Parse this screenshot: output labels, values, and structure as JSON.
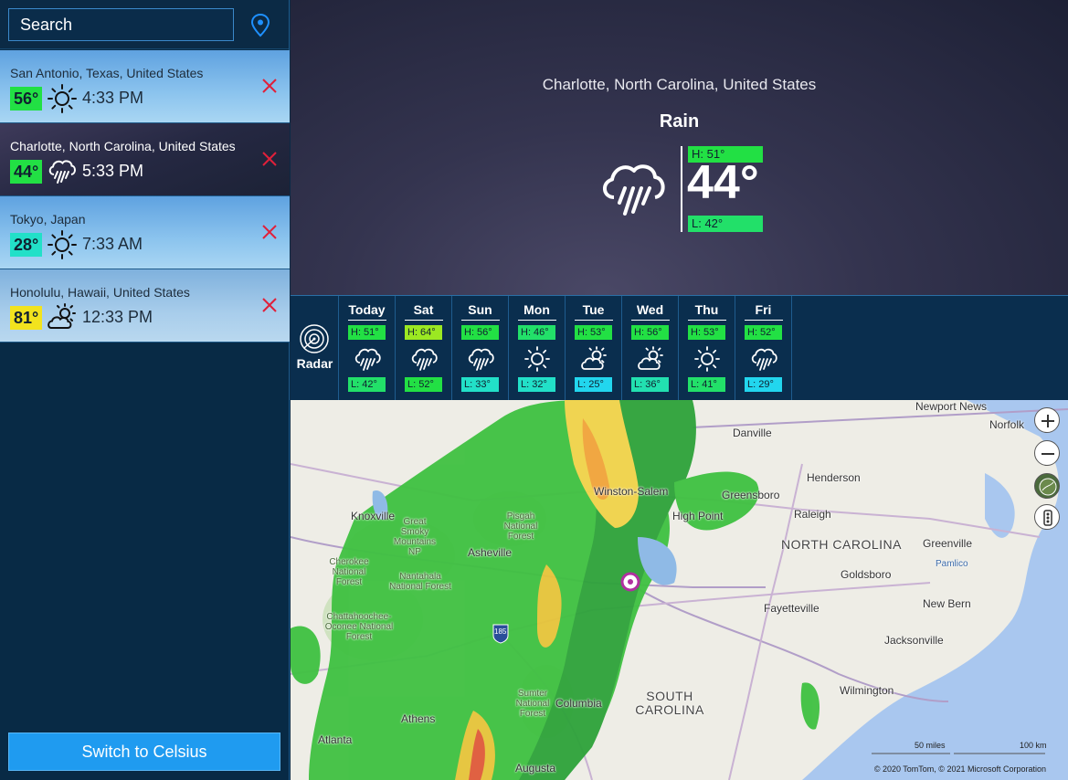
{
  "search": {
    "placeholder": "Search"
  },
  "cities": [
    {
      "name": "San Antonio, Texas, United States",
      "temp": "56°",
      "time": "4:33 PM",
      "icon": "sun-icon",
      "badge_color": "#22e044"
    },
    {
      "name": "Charlotte, North Carolina, United States",
      "temp": "44°",
      "time": "5:33 PM",
      "icon": "rain-icon",
      "badge_color": "#22e044"
    },
    {
      "name": "Tokyo, Japan",
      "temp": "28°",
      "time": "7:33 AM",
      "icon": "sun-icon",
      "badge_color": "#22e0c8"
    },
    {
      "name": "Honolulu, Hawaii, United States",
      "temp": "81°",
      "time": "12:33 PM",
      "icon": "partly-cloudy-icon",
      "badge_color": "#f2e31e"
    }
  ],
  "switch_button": {
    "label": "Switch to Celsius"
  },
  "current": {
    "location": "Charlotte, North Carolina, United States",
    "condition": "Rain",
    "temp": "44°",
    "high": "H: 51°",
    "low": "L: 42°",
    "icon": "rain-icon"
  },
  "radar": {
    "label": "Radar",
    "icon": "radar-icon"
  },
  "forecast": [
    {
      "day": "Today",
      "high": "H: 51°",
      "low": "L: 42°",
      "icon": "rain-icon",
      "high_color": "#22e044",
      "low_color": "#22e069"
    },
    {
      "day": "Sat",
      "high": "H: 64°",
      "low": "L: 52°",
      "icon": "rain-icon",
      "high_color": "#9be822",
      "low_color": "#22e044"
    },
    {
      "day": "Sun",
      "high": "H: 56°",
      "low": "L: 33°",
      "icon": "rain-icon",
      "high_color": "#22e044",
      "low_color": "#22e0c8"
    },
    {
      "day": "Mon",
      "high": "H: 46°",
      "low": "L: 32°",
      "icon": "sun-icon",
      "high_color": "#22e069",
      "low_color": "#22e0c8"
    },
    {
      "day": "Tue",
      "high": "H: 53°",
      "low": "L: 25°",
      "icon": "partly-cloudy-icon",
      "high_color": "#22e044",
      "low_color": "#22d6ee"
    },
    {
      "day": "Wed",
      "high": "H: 56°",
      "low": "L: 36°",
      "icon": "partly-cloudy-icon",
      "high_color": "#22e044",
      "low_color": "#22e0b0"
    },
    {
      "day": "Thu",
      "high": "H: 53°",
      "low": "L: 41°",
      "icon": "sun-icon",
      "high_color": "#22e044",
      "low_color": "#22e069"
    },
    {
      "day": "Fri",
      "high": "H: 52°",
      "low": "L: 29°",
      "icon": "rain-icon",
      "high_color": "#22e044",
      "low_color": "#22d6ee"
    }
  ],
  "map": {
    "labels": {
      "newport_news": "Newport News",
      "norfolk": "Norfolk",
      "danville": "Danville",
      "henderson": "Henderson",
      "winston_salem": "Winston-Salem",
      "greensboro": "Greensboro",
      "high_point": "High Point",
      "raleigh": "Raleigh",
      "north_carolina": "NORTH CAROLINA",
      "greenville": "Greenville",
      "knoxville": "Knoxville",
      "great_smoky": "Great Smoky Mountains NP",
      "pisgah": "Pisgah National Forest",
      "asheville": "Asheville",
      "cherokee": "Cherokee National Forest",
      "nantahala": "Nantahala National Forest",
      "goldsboro": "Goldsboro",
      "pamlico": "Pamlico",
      "fayetteville": "Fayetteville",
      "new_bern": "New Bern",
      "chattahoochee": "Chattahoochee-Oconee National Forest",
      "jacksonville": "Jacksonville",
      "south_carolina": "SOUTH CAROLINA",
      "columbia": "Columbia",
      "sumter": "Sumter National Forest",
      "wilmington": "Wilmington",
      "athens": "Athens",
      "atlanta": "Atlanta",
      "augusta": "Augusta",
      "i185": "185"
    },
    "scale_miles": "50 miles",
    "scale_km": "100 km",
    "attribution": "© 2020 TomTom, © 2021 Microsoft Corporation",
    "controls": [
      "zoom-in-icon",
      "zoom-out-icon",
      "map-style-icon",
      "traffic-icon"
    ]
  },
  "colors": {
    "sidebar_bg": "#082a45",
    "accent": "#1f9bf0",
    "remove": "#e0203a",
    "location_pin": "#1e90ff"
  }
}
